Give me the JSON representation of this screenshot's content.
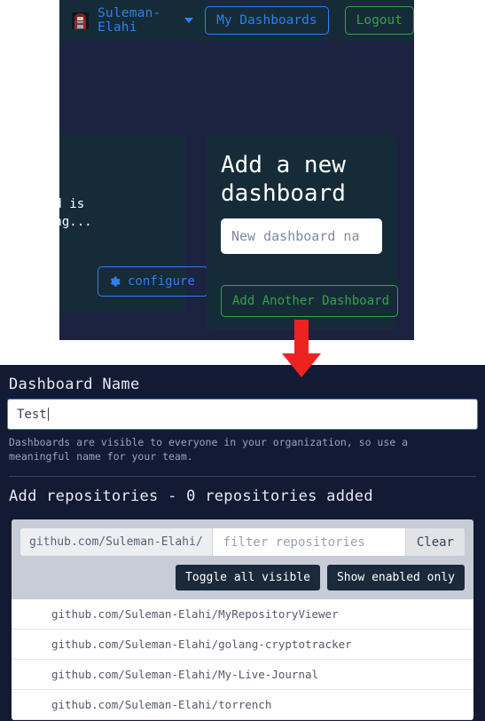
{
  "top_screenshot": {
    "navbar": {
      "avatar_icon": "user-avatar-pixelart",
      "username": "Suleman-Elahi",
      "caret_icon": "chevron-down-icon",
      "my_dashboards_label": "My Dashboards",
      "logout_label": "Logout",
      "accent_blue": "#2f7ff0",
      "accent_green": "#37a04a",
      "background": "#152c38"
    },
    "left_card": {
      "body_text": "rd is\ning...",
      "configure_label": "configure",
      "gear_icon": "gear-icon"
    },
    "right_card": {
      "title": "Add a new\ndashboard",
      "input_placeholder": "New dashboard na",
      "add_another_label": "Add Another Dashboard"
    },
    "page_background": "#1b2340"
  },
  "arrow": {
    "icon": "down-arrow-icon",
    "color": "#ef2222"
  },
  "bottom_screenshot": {
    "background": "#131a33",
    "dashboard_name": {
      "heading": "Dashboard Name",
      "value": "Test",
      "help_text": "Dashboards are visible to everyone in your organization, so use a meaningful name for your team."
    },
    "add_repositories": {
      "heading": "Add repositories - 0 repositories added",
      "owner_prefix": "github.com/Suleman-Elahi/",
      "filter_placeholder": "filter repositories",
      "clear_label": "Clear",
      "toggle_all_label": "Toggle all visible",
      "show_enabled_label": "Show enabled only",
      "repositories": [
        "github.com/Suleman-Elahi/MyRepositoryViewer",
        "github.com/Suleman-Elahi/golang-cryptotracker",
        "github.com/Suleman-Elahi/My-Live-Journal",
        "github.com/Suleman-Elahi/torrench"
      ]
    }
  }
}
